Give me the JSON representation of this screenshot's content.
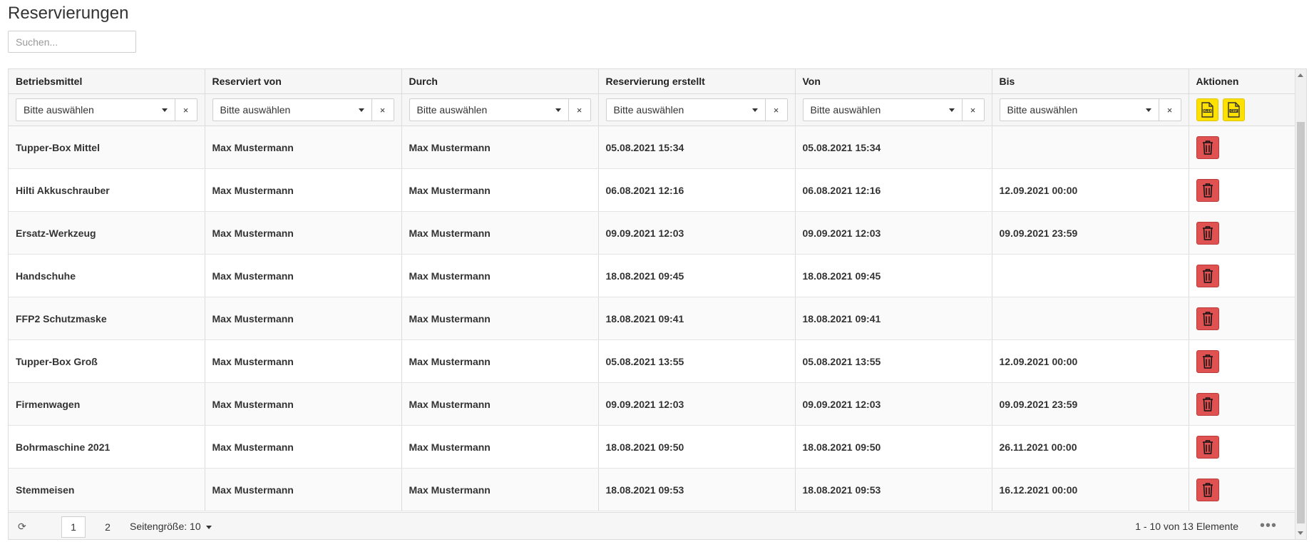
{
  "page": {
    "title": "Reservierungen",
    "search_placeholder": "Suchen..."
  },
  "table": {
    "columns": [
      "Betriebsmittel",
      "Reserviert von",
      "Durch",
      "Reservierung erstellt",
      "Von",
      "Bis",
      "Aktionen"
    ],
    "filter_placeholder": "Bitte auswählen",
    "filter_clear": "×",
    "export_buttons": [
      {
        "label": "XLSX",
        "icon": "excel-export-icon"
      },
      {
        "label": "CSV",
        "icon": "csv-export-icon"
      }
    ],
    "rows": [
      {
        "item": "Tupper-Box Mittel",
        "reserved_by": "Max Mustermann",
        "by": "Max Mustermann",
        "created": "05.08.2021 15:34",
        "from": "05.08.2021 15:34",
        "to": ""
      },
      {
        "item": "Hilti Akkuschrauber",
        "reserved_by": "Max Mustermann",
        "by": "Max Mustermann",
        "created": "06.08.2021 12:16",
        "from": "06.08.2021 12:16",
        "to": "12.09.2021 00:00"
      },
      {
        "item": "Ersatz-Werkzeug",
        "reserved_by": "Max Mustermann",
        "by": "Max Mustermann",
        "created": "09.09.2021 12:03",
        "from": "09.09.2021 12:03",
        "to": "09.09.2021 23:59"
      },
      {
        "item": "Handschuhe",
        "reserved_by": "Max Mustermann",
        "by": "Max Mustermann",
        "created": "18.08.2021 09:45",
        "from": "18.08.2021 09:45",
        "to": ""
      },
      {
        "item": "FFP2 Schutzmaske",
        "reserved_by": "Max Mustermann",
        "by": "Max Mustermann",
        "created": "18.08.2021 09:41",
        "from": "18.08.2021 09:41",
        "to": ""
      },
      {
        "item": "Tupper-Box Groß",
        "reserved_by": "Max Mustermann",
        "by": "Max Mustermann",
        "created": "05.08.2021 13:55",
        "from": "05.08.2021 13:55",
        "to": "12.09.2021 00:00"
      },
      {
        "item": "Firmenwagen",
        "reserved_by": "Max Mustermann",
        "by": "Max Mustermann",
        "created": "09.09.2021 12:03",
        "from": "09.09.2021 12:03",
        "to": "09.09.2021 23:59"
      },
      {
        "item": "Bohrmaschine 2021",
        "reserved_by": "Max Mustermann",
        "by": "Max Mustermann",
        "created": "18.08.2021 09:50",
        "from": "18.08.2021 09:50",
        "to": "26.11.2021 00:00"
      },
      {
        "item": "Stemmeisen",
        "reserved_by": "Max Mustermann",
        "by": "Max Mustermann",
        "created": "18.08.2021 09:53",
        "from": "18.08.2021 09:53",
        "to": "16.12.2021 00:00"
      }
    ]
  },
  "pager": {
    "refresh_icon": "refresh-icon",
    "pages": [
      "1",
      "2"
    ],
    "current_page": "1",
    "page_size_label": "Seitengröße: 10",
    "range_text": "1 - 10 von 13 Elemente",
    "more_icon": "•••"
  },
  "colors": {
    "export_button": "#ffe100",
    "delete_button": "#e05252",
    "header_bg": "#f6f6f6"
  }
}
